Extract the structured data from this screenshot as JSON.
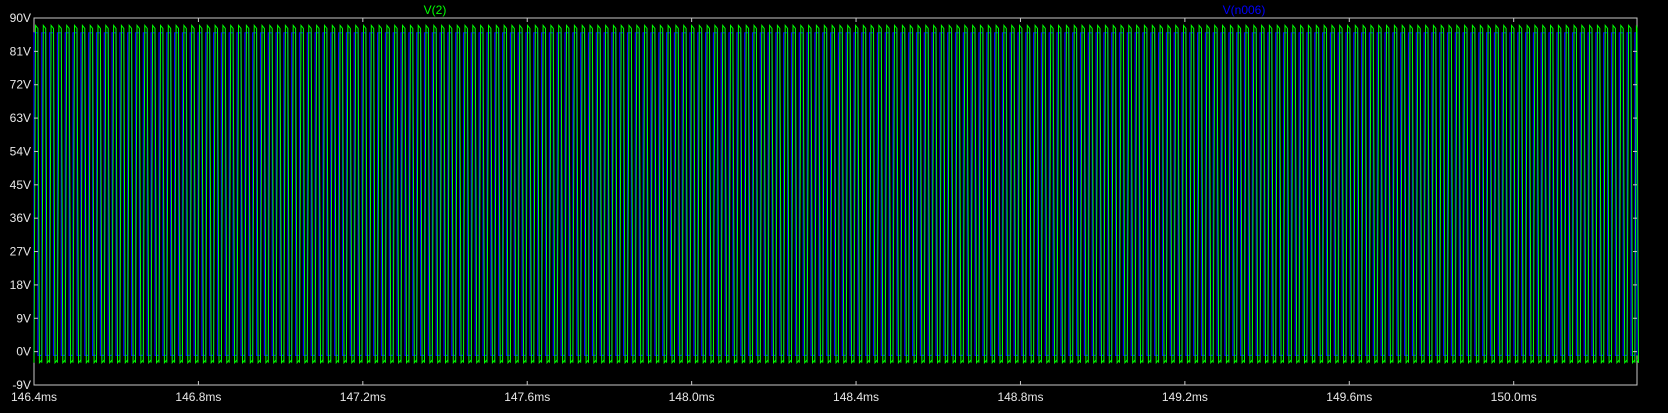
{
  "window": {
    "background": "#000000"
  },
  "chart_data": {
    "type": "line",
    "title": "",
    "xlabel": "",
    "ylabel": "",
    "grid": false,
    "x_unit": "ms",
    "y_unit": "V",
    "xlim": [
      146.4,
      150.3
    ],
    "ylim": [
      -9,
      90
    ],
    "x_ticks": [
      146.4,
      146.8,
      147.2,
      147.6,
      148.0,
      148.4,
      148.8,
      149.2,
      149.6,
      150.0
    ],
    "x_tick_labels": [
      "146.4ms",
      "146.8ms",
      "147.2ms",
      "147.6ms",
      "148.0ms",
      "148.4ms",
      "148.8ms",
      "149.2ms",
      "149.6ms",
      "150.0ms"
    ],
    "y_ticks": [
      90,
      81,
      72,
      63,
      54,
      45,
      36,
      27,
      18,
      9,
      0,
      -9
    ],
    "y_tick_labels": [
      "90V",
      "81V",
      "72V",
      "63V",
      "54V",
      "45V",
      "36V",
      "27V",
      "18V",
      "9V",
      "0V",
      "-9V"
    ],
    "series": [
      {
        "name": "V(2)",
        "color": "#00ff00",
        "kind": "pulse-train",
        "high_v": 88,
        "low_v": -3,
        "period_ms": 0.019,
        "duty": 0.5
      },
      {
        "name": "V(n006)",
        "color": "#0000ff",
        "kind": "pulse-train",
        "high_v": 86,
        "low_v": -1,
        "period_ms": 0.019,
        "duty": 0.5
      }
    ]
  }
}
